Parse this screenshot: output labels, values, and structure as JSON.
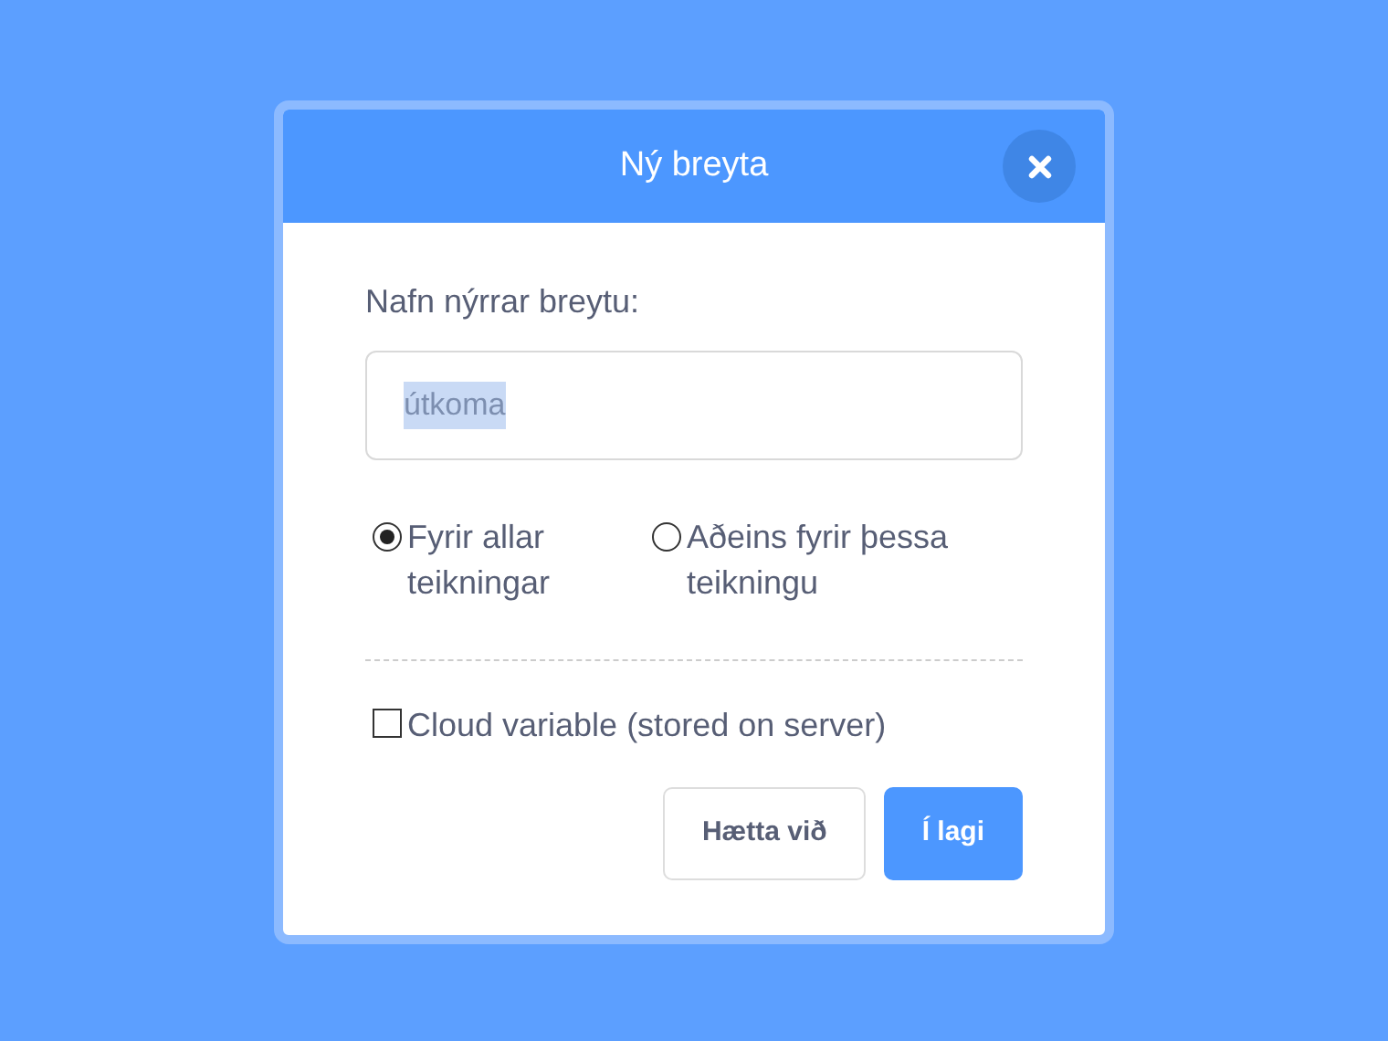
{
  "dialog": {
    "title": "Ný breyta"
  },
  "name_field": {
    "label": "Nafn nýrrar breytu:",
    "value": "útkoma",
    "text_selected": true
  },
  "scope_options": [
    {
      "label": "Fyrir allar teikningar",
      "selected": true
    },
    {
      "label": "Aðeins fyrir þessa teikningu",
      "selected": false
    }
  ],
  "cloud_option": {
    "label": "Cloud variable (stored on server)",
    "checked": false
  },
  "buttons": [
    {
      "label": "Hætta við",
      "kind": "secondary"
    },
    {
      "label": "Í lagi",
      "kind": "primary"
    }
  ]
}
